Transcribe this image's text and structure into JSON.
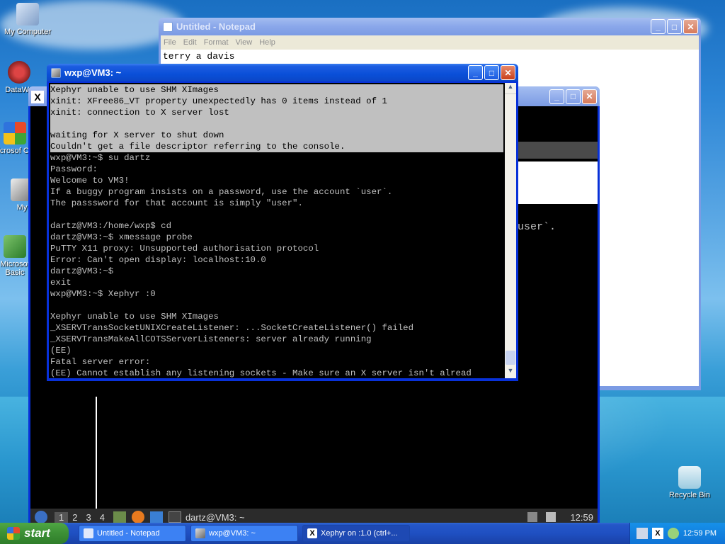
{
  "desktop": {
    "icons": [
      {
        "label": "My Computer"
      },
      {
        "label": "DataWa"
      },
      {
        "label": "Microsof C++"
      },
      {
        "label": "My"
      },
      {
        "label": "Microsof Basic"
      },
      {
        "label": "Recycle Bin"
      }
    ]
  },
  "notepad": {
    "title": "Untitled - Notepad",
    "menu": [
      "File",
      "Edit",
      "Format",
      "View",
      "Help"
    ],
    "text": "terry a davis"
  },
  "xephyr_window": {
    "partial_text": "user`.",
    "panel": {
      "workspaces": [
        "1",
        "2",
        "3",
        "4"
      ],
      "task_label": "dartz@VM3: ~",
      "clock": "12:59"
    }
  },
  "putty": {
    "title": "wxp@VM3: ~",
    "lines": [
      {
        "text": "Xephyr unable to use SHM XImages",
        "selected": true
      },
      {
        "text": "xinit: XFree86_VT property unexpectedly has 0 items instead of 1",
        "selected": true
      },
      {
        "text": "xinit: connection to X server lost",
        "selected": true
      },
      {
        "text": "",
        "selected": true
      },
      {
        "text": "waiting for X server to shut down",
        "selected": true
      },
      {
        "text": "Couldn't get a file descriptor referring to the console.",
        "selected": true
      },
      {
        "text": "wxp@VM3:~$ su dartz",
        "selected": false
      },
      {
        "text": "Password:",
        "selected": false
      },
      {
        "text": "Welcome to VM3!",
        "selected": false
      },
      {
        "text": "If a buggy program insists on a password, use the account `user`.",
        "selected": false
      },
      {
        "text": "The passsword for that account is simply \"user\".",
        "selected": false
      },
      {
        "text": "",
        "selected": false
      },
      {
        "text": "dartz@VM3:/home/wxp$ cd",
        "selected": false
      },
      {
        "text": "dartz@VM3:~$ xmessage probe",
        "selected": false
      },
      {
        "text": "PuTTY X11 proxy: Unsupported authorisation protocol",
        "selected": false
      },
      {
        "text": "Error: Can't open display: localhost:10.0",
        "selected": false
      },
      {
        "text": "dartz@VM3:~$",
        "selected": false
      },
      {
        "text": "exit",
        "selected": false
      },
      {
        "text": "wxp@VM3:~$ Xephyr :0",
        "selected": false
      },
      {
        "text": "",
        "selected": false
      },
      {
        "text": "Xephyr unable to use SHM XImages",
        "selected": false
      },
      {
        "text": "_XSERVTransSocketUNIXCreateListener: ...SocketCreateListener() failed",
        "selected": false
      },
      {
        "text": "_XSERVTransMakeAllCOTSServerListeners: server already running",
        "selected": false
      },
      {
        "text": "(EE)",
        "selected": false
      },
      {
        "text": "Fatal server error:",
        "selected": false
      },
      {
        "text": "(EE) Cannot establish any listening sockets - Make sure an X server isn't alread",
        "selected": false
      }
    ]
  },
  "taskbar": {
    "start_label": "start",
    "tasks": [
      {
        "label": "Untitled - Notepad"
      },
      {
        "label": "wxp@VM3: ~"
      },
      {
        "label": "Xephyr on :1.0 (ctrl+..."
      }
    ],
    "clock": "12:59 PM"
  }
}
